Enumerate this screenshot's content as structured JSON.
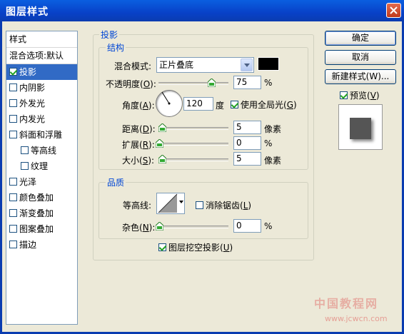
{
  "window": {
    "title": "图层样式"
  },
  "stylelist": {
    "header": "样式",
    "blend_options": "混合选项:默认",
    "items": [
      {
        "label": "投影",
        "checked": true,
        "selected": true
      },
      {
        "label": "内阴影",
        "checked": false
      },
      {
        "label": "外发光",
        "checked": false
      },
      {
        "label": "内发光",
        "checked": false
      },
      {
        "label": "斜面和浮雕",
        "checked": false
      },
      {
        "label": "等高线",
        "checked": false,
        "sub": true
      },
      {
        "label": "纹理",
        "checked": false,
        "sub": true
      },
      {
        "label": "光泽",
        "checked": false
      },
      {
        "label": "颜色叠加",
        "checked": false
      },
      {
        "label": "渐变叠加",
        "checked": false
      },
      {
        "label": "图案叠加",
        "checked": false
      },
      {
        "label": "描边",
        "checked": false
      }
    ]
  },
  "shadow": {
    "group_label": "投影",
    "structure": {
      "label": "结构",
      "blend_mode_label": "混合模式:",
      "blend_mode_value": "正片叠底",
      "shadow_color": "#000000",
      "opacity_label_pre": "不透明度(",
      "opacity_key": "O",
      "opacity_label_post": "):",
      "opacity_value": "75",
      "opacity_unit": "%",
      "angle_label_pre": "角度(",
      "angle_key": "A",
      "angle_label_post": "):",
      "angle_value": "120",
      "angle_unit": "度",
      "global_light_pre": "使用全局光(",
      "global_light_key": "G",
      "global_light_post": ")",
      "global_light_checked": true,
      "distance_label_pre": "距离(",
      "distance_key": "D",
      "distance_label_post": "):",
      "distance_value": "5",
      "distance_unit": "像素",
      "spread_label_pre": "扩展(",
      "spread_key": "R",
      "spread_label_post": "):",
      "spread_value": "0",
      "spread_unit": "%",
      "size_label_pre": "大小(",
      "size_key": "S",
      "size_label_post": "):",
      "size_value": "5",
      "size_unit": "像素"
    },
    "quality": {
      "label": "品质",
      "contour_label": "等高线:",
      "antialias_pre": "消除锯齿(",
      "antialias_key": "L",
      "antialias_post": ")",
      "antialias_checked": false,
      "noise_label_pre": "杂色(",
      "noise_key": "N",
      "noise_label_post": "):",
      "noise_value": "0",
      "noise_unit": "%"
    },
    "knockout_pre": "图层挖空投影(",
    "knockout_key": "U",
    "knockout_post": ")",
    "knockout_checked": true
  },
  "buttons": {
    "ok": "确定",
    "cancel": "取消",
    "new_style": "新建样式(W)...",
    "preview_pre": "预览(",
    "preview_key": "V",
    "preview_post": ")",
    "preview_checked": true
  },
  "watermark": {
    "line1": "中国教程网",
    "line2": "www.jcwcn.com"
  }
}
